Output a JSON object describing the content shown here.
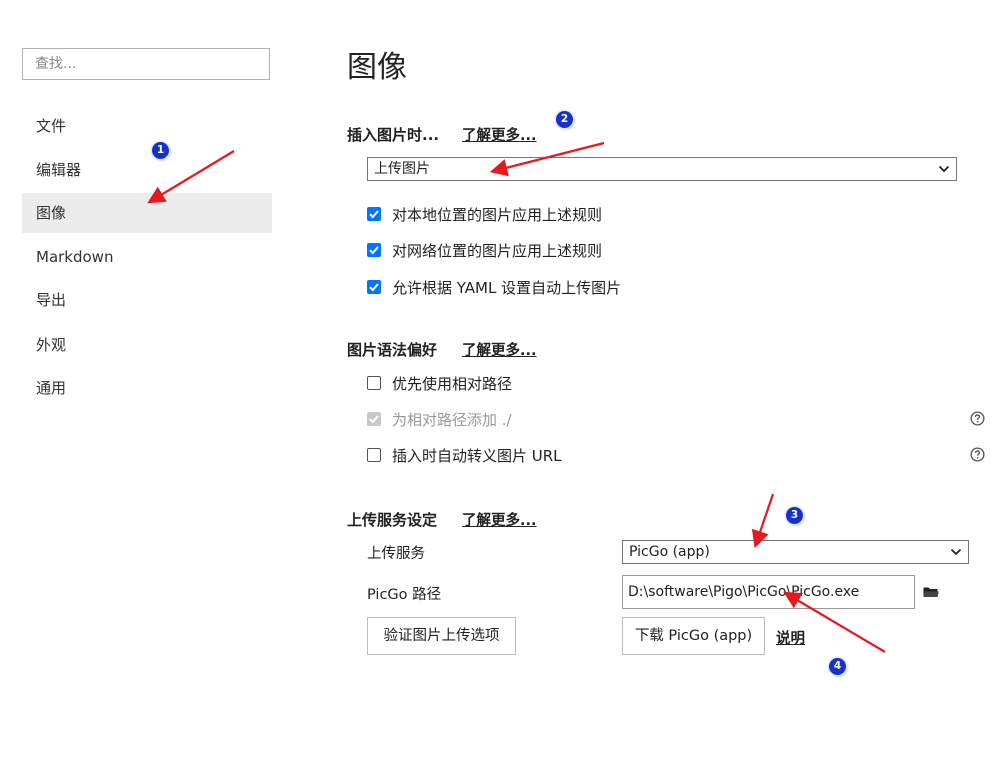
{
  "sidebar": {
    "search_placeholder": "查找...",
    "items": [
      {
        "label": "文件",
        "active": false
      },
      {
        "label": "编辑器",
        "active": false
      },
      {
        "label": "图像",
        "active": true
      },
      {
        "label": "Markdown",
        "active": false
      },
      {
        "label": "导出",
        "active": false
      },
      {
        "label": "外观",
        "active": false
      },
      {
        "label": "通用",
        "active": false
      }
    ]
  },
  "main": {
    "title": "图像",
    "insert_section": {
      "title": "插入图片时...",
      "learn_more": "了解更多...",
      "action_value": "上传图片",
      "options": [
        {
          "label": "对本地位置的图片应用上述规则",
          "checked": true
        },
        {
          "label": "对网络位置的图片应用上述规则",
          "checked": true
        },
        {
          "label": "允许根据 YAML 设置自动上传图片",
          "checked": true
        }
      ]
    },
    "syntax_section": {
      "title": "图片语法偏好",
      "learn_more": "了解更多...",
      "options": [
        {
          "label": "优先使用相对路径",
          "checked": false,
          "disabled": false
        },
        {
          "label": "为相对路径添加 ./",
          "checked": true,
          "disabled": true
        },
        {
          "label": "插入时自动转义图片 URL",
          "checked": false,
          "disabled": false
        }
      ]
    },
    "upload_section": {
      "title": "上传服务设定",
      "learn_more": "了解更多...",
      "service_label": "上传服务",
      "service_value": "PicGo (app)",
      "path_label": "PicGo 路径",
      "path_value": "D:\\software\\Pigo\\PicGo\\PicGo.exe",
      "verify_button": "验证图片上传选项",
      "download_button": "下载 PicGo (app)",
      "explain_link": "说明"
    }
  },
  "annotations": {
    "badges": [
      "1",
      "2",
      "3",
      "4"
    ],
    "arrow_color": "#e8191c",
    "badge_color": "#1631c8"
  },
  "colors": {
    "checkbox_accent": "#0075ff",
    "active_nav_bg": "#ececec"
  }
}
